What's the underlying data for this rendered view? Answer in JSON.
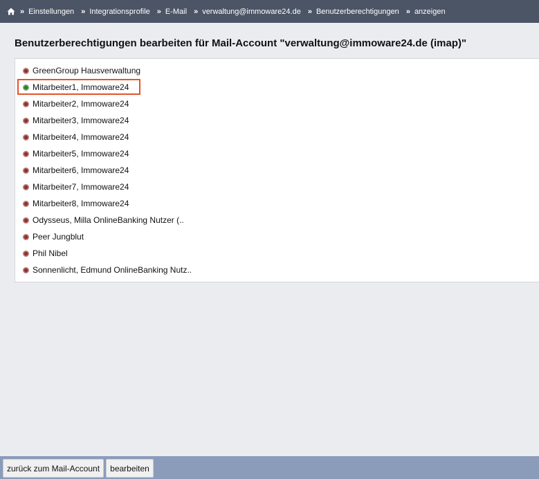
{
  "breadcrumb": {
    "items": [
      {
        "label": "Einstellungen"
      },
      {
        "label": "Integrationsprofile"
      },
      {
        "label": "E-Mail"
      },
      {
        "label": "verwaltung@immoware24.de"
      },
      {
        "label": "Benutzerberechtigungen"
      },
      {
        "label": "anzeigen"
      }
    ],
    "separator": "»"
  },
  "page": {
    "title": "Benutzerberechtigungen bearbeiten für Mail-Account \"verwaltung@immoware24.de (imap)\""
  },
  "users": [
    {
      "name": "GreenGroup Hausverwaltung",
      "status": "red"
    },
    {
      "name": "Mitarbeiter1, Immoware24",
      "status": "green"
    },
    {
      "name": "Mitarbeiter2, Immoware24",
      "status": "red"
    },
    {
      "name": "Mitarbeiter3, Immoware24",
      "status": "red"
    },
    {
      "name": "Mitarbeiter4, Immoware24",
      "status": "red"
    },
    {
      "name": "Mitarbeiter5, Immoware24",
      "status": "red"
    },
    {
      "name": "Mitarbeiter6, Immoware24",
      "status": "red"
    },
    {
      "name": "Mitarbeiter7, Immoware24",
      "status": "red"
    },
    {
      "name": "Mitarbeiter8, Immoware24",
      "status": "red"
    },
    {
      "name": "Odysseus, Milla OnlineBanking Nutzer (..",
      "status": "red"
    },
    {
      "name": "Peer Jungblut",
      "status": "red"
    },
    {
      "name": "Phil Nibel",
      "status": "red"
    },
    {
      "name": "Sonnenlicht, Edmund OnlineBanking Nutz..",
      "status": "red"
    }
  ],
  "footer": {
    "back_label": "zurück zum Mail-Account",
    "edit_label": "bearbeiten"
  },
  "colors": {
    "topbar": "#4c5566",
    "footer": "#8b9bba",
    "background": "#ebecf0",
    "highlight": "#e2542a",
    "status_red": "#8a2f2a",
    "status_green": "#2f7a2f"
  },
  "icons": {
    "home": "home-icon"
  }
}
